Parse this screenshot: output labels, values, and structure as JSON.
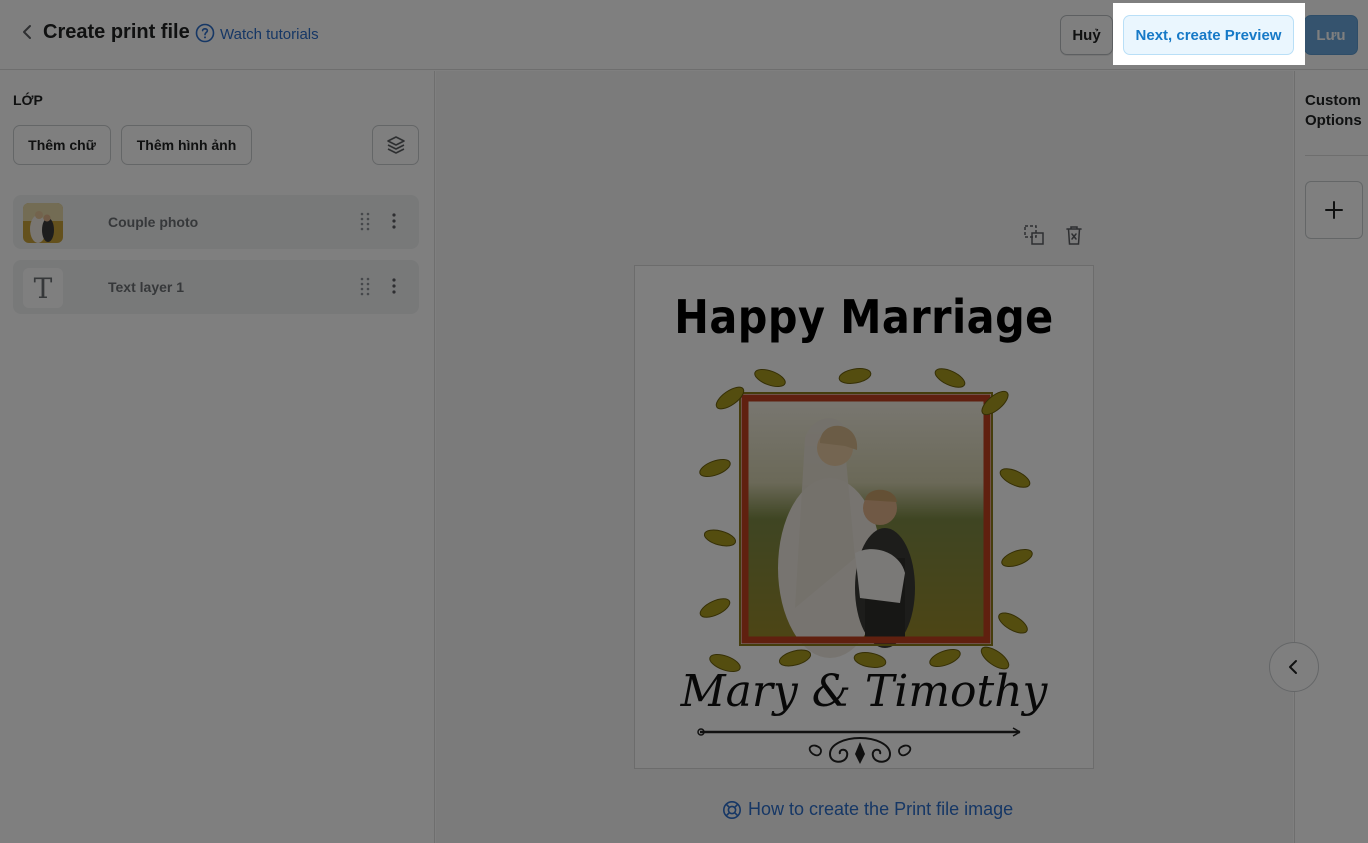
{
  "header": {
    "title": "Create print file",
    "tutorial_link": "Watch tutorials",
    "cancel_label": "Huỷ",
    "preview_label": "Next, create Preview",
    "save_label": "Lưu"
  },
  "layers_panel": {
    "title": "LỚP",
    "add_text_label": "Thêm chữ",
    "add_image_label": "Thêm hình ảnh",
    "items": [
      {
        "label": "Couple photo",
        "type": "image"
      },
      {
        "label": "Text layer 1",
        "type": "text",
        "icon_glyph": "T"
      }
    ]
  },
  "canvas": {
    "design_title": "Happy Marriage",
    "design_names": "Mary & Timothy",
    "help_link": "How to create the Print file image"
  },
  "right_panel": {
    "title": "Custom Options",
    "add_glyph": "+"
  },
  "colors": {
    "primary": "#2c6ecb",
    "preview_bg": "#eaf6fe",
    "preview_text": "#1679c7",
    "save_bg": "#6aa7dc",
    "overlay": "rgba(0,0,0,0.5)",
    "frame_red": "#c0401f",
    "leaf_olive": "#a89a1e"
  },
  "icons": [
    "back-chevron-icon",
    "help-circle-icon",
    "layers-stack-icon",
    "drag-handle-icon",
    "more-vertical-icon",
    "duplicate-icon",
    "trash-icon",
    "lifebuoy-icon",
    "plus-icon",
    "chevron-left-icon"
  ]
}
